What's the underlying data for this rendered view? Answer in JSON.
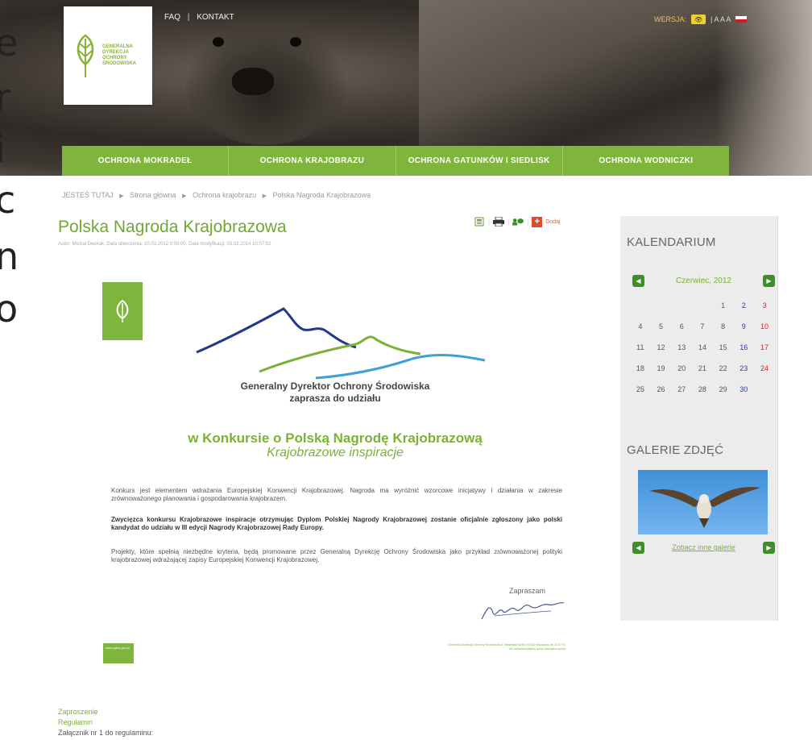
{
  "left_clip": [
    "e",
    "r",
    "i",
    "c",
    "n",
    "o"
  ],
  "header": {
    "top_links": {
      "faq": "FAQ",
      "separator": "|",
      "contact": "KONTAKT"
    },
    "version_label": "WERSJA:",
    "font_sizes": "|  A A A",
    "logo_lines": [
      "GENERALNA",
      "DYREKCJA",
      "OCHRONY",
      "ŚRODOWISKA"
    ]
  },
  "nav": {
    "items": [
      "OCHRONA MOKRADEŁ",
      "OCHRONA KRAJOBRAZU",
      "OCHRONA GATUNKÓW I SIEDLISK",
      "OCHRONA WODNICZKI"
    ]
  },
  "breadcrumb": {
    "items": [
      "JESTEŚ TUTAJ",
      "Strona główna",
      "Ochrona krajobrazu",
      "Polska Nagroda Krajobrazowa"
    ]
  },
  "article": {
    "title": "Polska Nagroda Krajobrazowa",
    "meta": "Autor: Michał Dworak, Data utworzenia: 20.03.2012 0:00:00, Data modyfikacji: 03.02.2014 10:07:52",
    "add_label": "Dodaj"
  },
  "invitation": {
    "head_line1": "Generalny Dyrektor Ochrony Środowiska",
    "head_line2": "zaprasza do udziału",
    "title": "w Konkursie o Polską Nagrodę Krajobrazową",
    "subtitle": "Krajobrazowe inspiracje",
    "para1": "Konkurs jest elementem wdrażania Europejskiej Konwencji Krajobrazowej. Nagroda ma wyróżnić wzorcowe inicjatywy i działania w zakresie zrównoważonego planowania i gospodarowania krajobrazem.",
    "para2": "Zwycięzca konkursu Krajobrazowe inspiracje otrzymując Dyplom Polskiej Nagrody Krajobrazowej zostanie oficjalnie zgłoszony jako polski kandydat do udziału w III edycji Nagrody Krajobrazowej Rady Europy.",
    "para3": "Projekty, które spełnią niezbędne kryteria, będą promowane przez Generalną Dyrekcję Ochrony Środowiska jako przykład zrównoważonej polityki krajobrazowej wdrażającej zapisy Europejskiej Konwencji Krajobrazowej.",
    "closing": "Zapraszam",
    "footer_logo_text": "www.gdos.gov.pl",
    "footer_address": "Generalna Dyrekcja Ochrony Środowiska ul. Wawelska 52/54, 00-922 Warszawa tel. 22 57 92 100 kancelaria@gdos.gov.pl www.gdos.gov.pl"
  },
  "attachments": {
    "items": [
      "Zaproszenie",
      "Regulamin",
      "Załącznik nr 1 do regulaminu:"
    ]
  },
  "sidebar": {
    "calendar_title": "KALENDARIUM",
    "month": "Czerwiec, 2012",
    "weeks": [
      [
        "",
        "",
        "",
        "",
        "1",
        "2",
        "3"
      ],
      [
        "4",
        "5",
        "6",
        "7",
        "8",
        "9",
        "10"
      ],
      [
        "11",
        "12",
        "13",
        "14",
        "15",
        "16",
        "17"
      ],
      [
        "18",
        "19",
        "20",
        "21",
        "22",
        "23",
        "24"
      ],
      [
        "25",
        "26",
        "27",
        "28",
        "29",
        "30",
        ""
      ]
    ],
    "gallery_title": "GALERIE ZDJĘĆ",
    "gallery_link": "Zobacz inne galerie"
  },
  "colors": {
    "accent_green": "#80b53d",
    "link_green": "#7ab235",
    "saturday_blue": "#2b3aa6",
    "sunday_red": "#d4232b",
    "add_red": "#e04b2c",
    "sidebar_bg": "#ececec"
  },
  "icons": [
    "logo-leaf-icon",
    "eye-icon",
    "flag-icon",
    "pdf-icon",
    "print-icon",
    "share-icon",
    "add-icon",
    "arrow-left-icon",
    "arrow-right-icon",
    "signature-icon"
  ]
}
